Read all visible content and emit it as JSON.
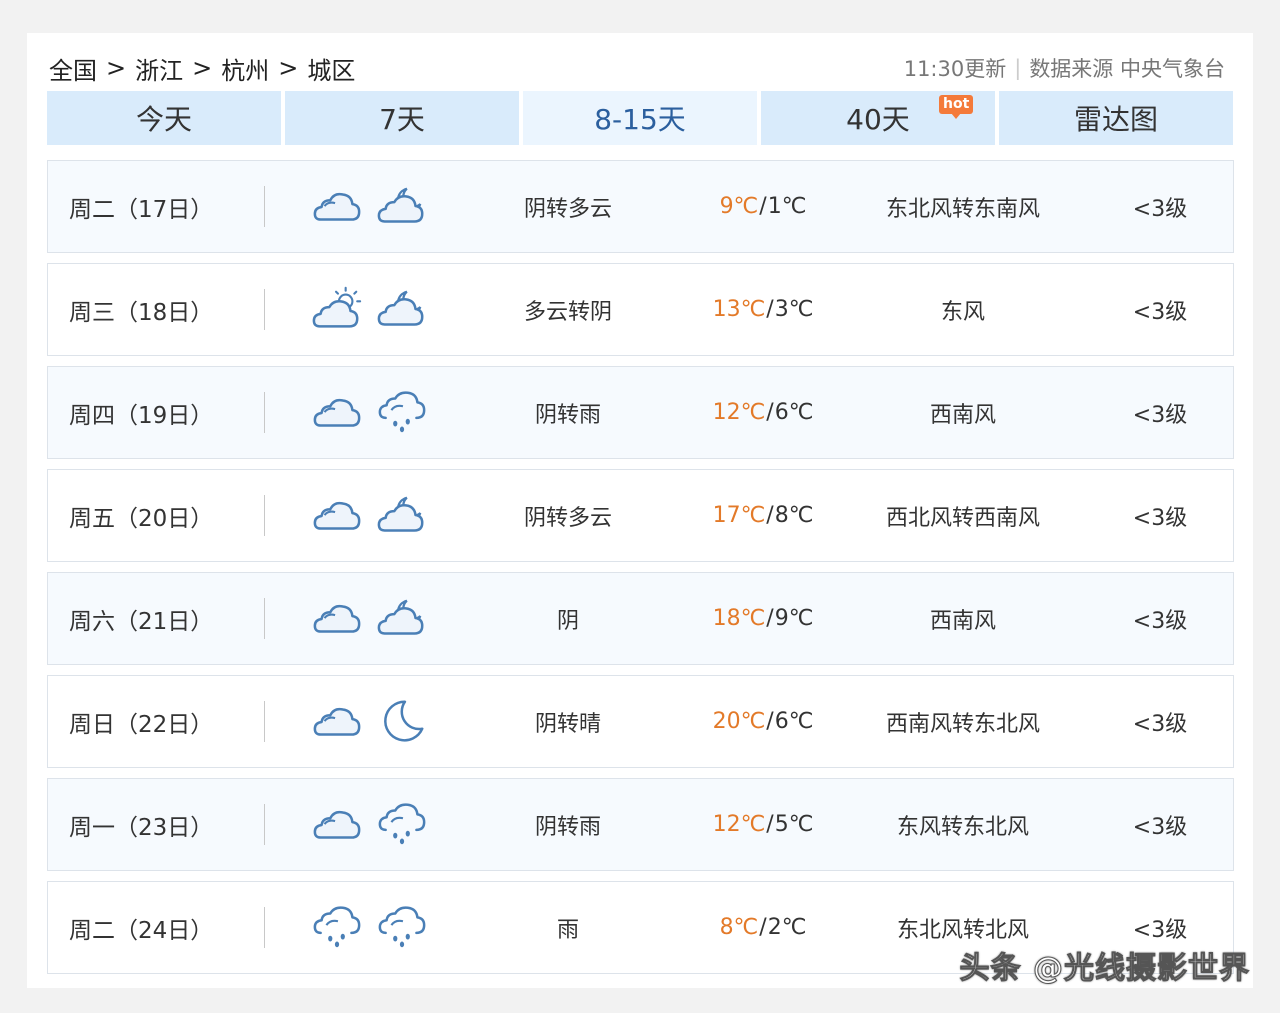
{
  "breadcrumb": [
    "全国",
    "浙江",
    "杭州",
    "城区"
  ],
  "breadcrumb_separator": ">",
  "update_time": "11:30更新",
  "divider": "|",
  "data_source": "数据来源 中央气象台",
  "tabs": [
    {
      "label": "今天"
    },
    {
      "label": "7天"
    },
    {
      "label": "8-15天",
      "active": true
    },
    {
      "label": "40天",
      "badge": "hot"
    },
    {
      "label": "雷达图"
    }
  ],
  "forecast": [
    {
      "day": "周二（17日）",
      "icons": [
        "cloudy-icon",
        "partly-cloudy-night-icon"
      ],
      "desc": "阴转多云",
      "high": "9℃",
      "low": "1℃",
      "wind": "东北风转东南风",
      "level": "<3级"
    },
    {
      "day": "周三（18日）",
      "icons": [
        "partly-cloudy-day-icon",
        "partly-cloudy-night-icon"
      ],
      "desc": "多云转阴",
      "high": "13℃",
      "low": "3℃",
      "wind": "东风",
      "level": "<3级"
    },
    {
      "day": "周四（19日）",
      "icons": [
        "cloudy-icon",
        "rain-icon"
      ],
      "desc": "阴转雨",
      "high": "12℃",
      "low": "6℃",
      "wind": "西南风",
      "level": "<3级"
    },
    {
      "day": "周五（20日）",
      "icons": [
        "cloudy-icon",
        "partly-cloudy-night-icon"
      ],
      "desc": "阴转多云",
      "high": "17℃",
      "low": "8℃",
      "wind": "西北风转西南风",
      "level": "<3级"
    },
    {
      "day": "周六（21日）",
      "icons": [
        "cloudy-icon",
        "partly-cloudy-night-icon"
      ],
      "desc": "阴",
      "high": "18℃",
      "low": "9℃",
      "wind": "西南风",
      "level": "<3级"
    },
    {
      "day": "周日（22日）",
      "icons": [
        "cloudy-icon",
        "moon-icon"
      ],
      "desc": "阴转晴",
      "high": "20℃",
      "low": "6℃",
      "wind": "西南风转东北风",
      "level": "<3级"
    },
    {
      "day": "周一（23日）",
      "icons": [
        "cloudy-icon",
        "rain-icon"
      ],
      "desc": "阴转雨",
      "high": "12℃",
      "low": "5℃",
      "wind": "东风转东北风",
      "level": "<3级"
    },
    {
      "day": "周二（24日）",
      "icons": [
        "rain-icon",
        "rain-icon"
      ],
      "desc": "雨",
      "high": "8℃",
      "low": "2℃",
      "wind": "东北风转北风",
      "level": "<3级"
    }
  ],
  "temp_separator": "/",
  "watermark": "头条 @光线摄影世界",
  "colors": {
    "tab_bg": "#d9ebfb",
    "tab_active_text": "#2b5f9e",
    "high_temp": "#e37a29",
    "icon_stroke": "#4a7fb6",
    "hot_badge": "#f47a3a"
  }
}
